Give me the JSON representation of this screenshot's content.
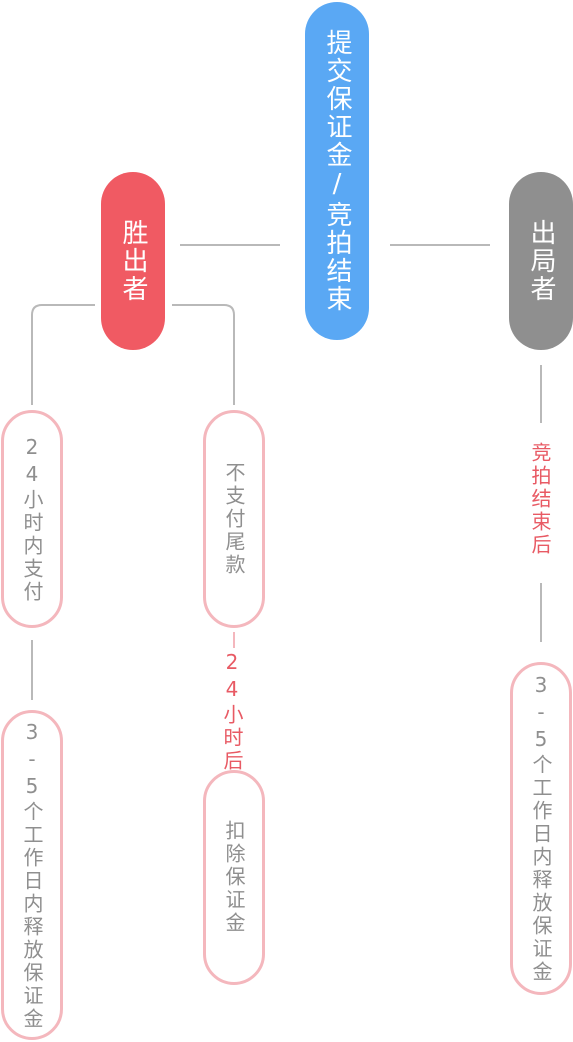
{
  "colors": {
    "root": "#5aa8f4",
    "winner": "#f05a63",
    "loser": "#8f8f8f",
    "outline": "#f4b7bd",
    "note": "#e85a64",
    "line": "#b9b9b9"
  },
  "root": {
    "label": "提交保证金/竞拍结束"
  },
  "winner": {
    "label": "胜出者",
    "pay_path": {
      "step1": "24小时内支付",
      "step2": "3-5个工作日内释放保证金"
    },
    "nopay_path": {
      "step1": "不支付尾款",
      "note": "24小时后",
      "step2": "扣除保证金"
    }
  },
  "loser": {
    "label": "出局者",
    "note": "竞拍结束后",
    "step1": "3-5个工作日内释放保证金"
  }
}
